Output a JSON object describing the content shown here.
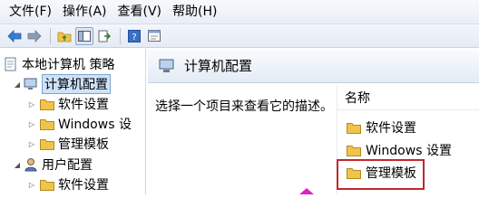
{
  "menu": {
    "file": "文件(F)",
    "action": "操作(A)",
    "view": "查看(V)",
    "help": "帮助(H)"
  },
  "tree": {
    "root": "本地计算机 策略",
    "computer_config": "计算机配置",
    "software_settings": "软件设置",
    "windows_settings": "Windows 设",
    "admin_templates": "管理模板",
    "user_config": "用户配置",
    "user_software_settings": "软件设置"
  },
  "right": {
    "header_title": "计算机配置",
    "description": "选择一个项目来查看它的描述。",
    "column_name": "名称",
    "items": [
      "软件设置",
      "Windows 设置",
      "管理模板"
    ]
  },
  "colors": {
    "highlight_border": "#c0272d",
    "folder": "#f0c44a",
    "selection": "#cde3fb"
  }
}
